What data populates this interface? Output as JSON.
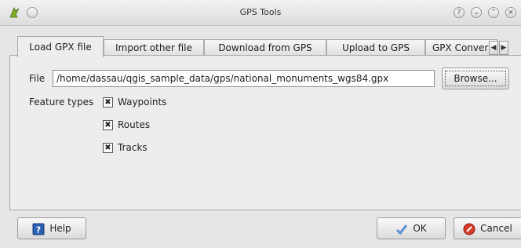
{
  "window": {
    "title": "GPS Tools"
  },
  "tabs": [
    {
      "label": "Load GPX file"
    },
    {
      "label": "Import other file"
    },
    {
      "label": "Download from GPS"
    },
    {
      "label": "Upload to GPS"
    },
    {
      "label": "GPX Convers"
    }
  ],
  "form": {
    "file_label": "File",
    "file_value": "/home/dassau/qgis_sample_data/gps/national_monuments_wgs84.gpx",
    "browse_label": "Browse...",
    "feature_types_label": "Feature types",
    "checkboxes": [
      {
        "label": "Waypoints",
        "checked": true
      },
      {
        "label": "Routes",
        "checked": true
      },
      {
        "label": "Tracks",
        "checked": true
      }
    ]
  },
  "buttons": {
    "help": "Help",
    "ok": "OK",
    "cancel": "Cancel"
  },
  "colors": {
    "help_icon": "#2a5fb3",
    "cancel_icon": "#d83a2a",
    "ok_icon": "#5b8fd0"
  }
}
